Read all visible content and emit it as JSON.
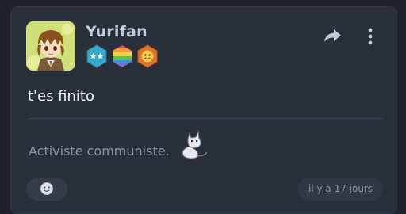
{
  "post": {
    "author": "Yurifan",
    "text": "t'es finito",
    "bio": "Activiste communiste.",
    "timestamp": "il y a 17 jours"
  },
  "badges": [
    {
      "icon": "two-stars-badge-icon",
      "color": "#37a8c8"
    },
    {
      "icon": "rainbow-badge-icon",
      "color": "#e65aa0"
    },
    {
      "icon": "emoji-face-badge-icon",
      "color": "#e0742c"
    }
  ],
  "icons": {
    "share": "share-arrow-icon",
    "menu": "vertical-dots-icon",
    "reaction": "smiley-face-icon",
    "sticker": "cat-sticker-icon"
  },
  "colors": {
    "background": "#1f2329",
    "card": "#2a303a",
    "username": "#c3cbd8",
    "text": "#f0f2f5",
    "muted": "#8792a2"
  }
}
